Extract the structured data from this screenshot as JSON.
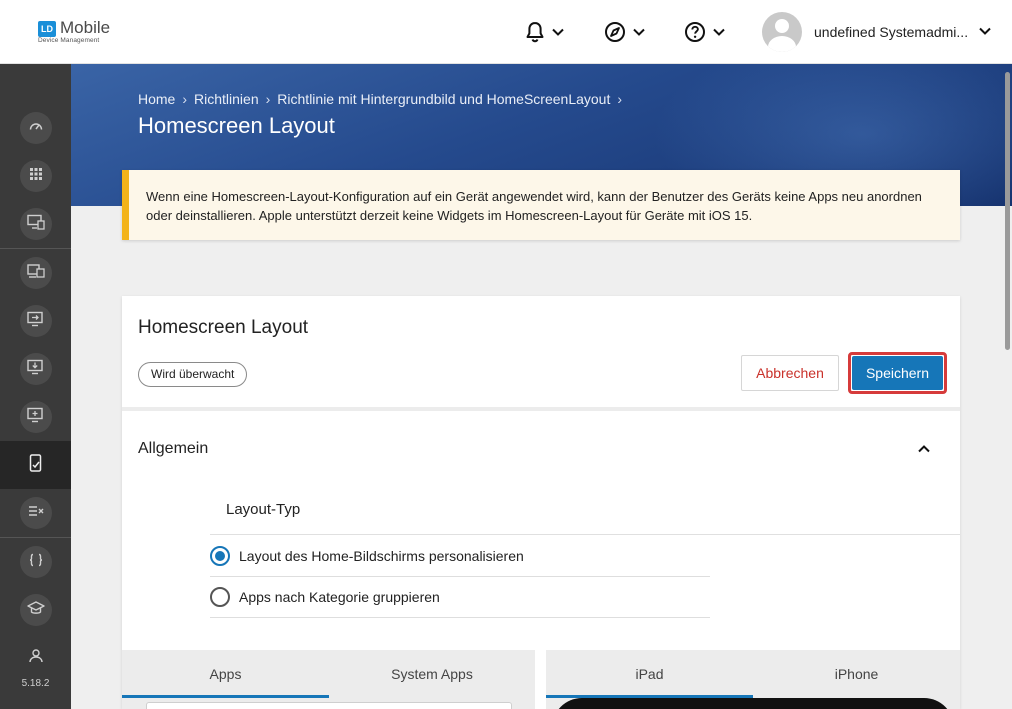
{
  "topbar": {
    "logo_mark": "LD",
    "logo_name": "Mobile",
    "logo_sub": "Device Management",
    "user_name": "undefined Systemadmi..."
  },
  "sidebar": {
    "items": [
      {
        "icon": "dashboard-icon"
      },
      {
        "icon": "apps-grid-icon"
      },
      {
        "icon": "device-settings-icon"
      },
      {
        "icon": "devices-icon"
      },
      {
        "icon": "device-transfer-icon"
      },
      {
        "icon": "device-download-icon"
      },
      {
        "icon": "device-add-icon"
      },
      {
        "icon": "device-policy-icon",
        "active": true
      },
      {
        "icon": "compliance-icon"
      },
      {
        "icon": "code-braces-icon"
      },
      {
        "icon": "education-icon"
      },
      {
        "icon": "users-icon"
      }
    ],
    "version": "5.18.2"
  },
  "hero": {
    "breadcrumbs": [
      "Home",
      "Richtlinien",
      "Richtlinie mit Hintergrundbild und HomeScreenLayout"
    ],
    "title": "Homescreen Layout"
  },
  "warning": {
    "text": "Wenn eine Homescreen-Layout-Konfiguration auf ein Gerät angewendet wird, kann der Benutzer des Geräts keine Apps neu anordnen oder deinstallieren. Apple unterstützt derzeit keine Widgets im Homescreen-Layout für Geräte mit iOS 15."
  },
  "card": {
    "title": "Homescreen Layout",
    "badge": "Wird überwacht",
    "cancel_label": "Abbrechen",
    "save_label": "Speichern",
    "section_title": "Allgemein",
    "layout_type_label": "Layout-Typ",
    "options": [
      {
        "label": "Layout des Home-Bildschirms personalisieren",
        "checked": true
      },
      {
        "label": "Apps nach Kategorie gruppieren",
        "checked": false
      }
    ],
    "left_tabs": [
      "Apps",
      "System Apps"
    ],
    "right_tabs": [
      "iPad",
      "iPhone"
    ]
  },
  "colors": {
    "accent": "#1676b8",
    "warning_border": "#f3b31a",
    "cancel_text": "#c9312a",
    "highlight": "#d63b3b"
  }
}
